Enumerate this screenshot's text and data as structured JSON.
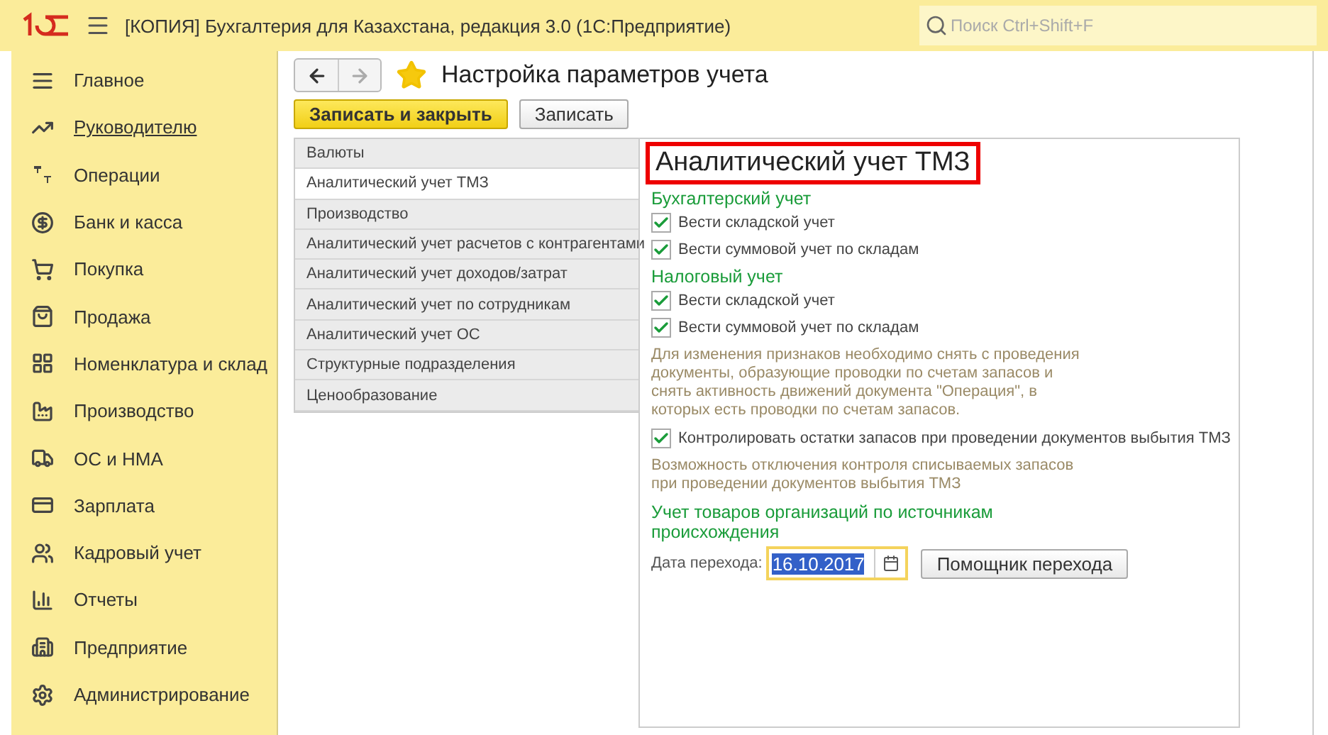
{
  "window": {
    "title": "[КОПИЯ] Бухгалтерия для Казахстана, редакция 3.0  (1С:Предприятие)",
    "search": {
      "placeholder": "Поиск Ctrl+Shift+F"
    }
  },
  "sidebar": {
    "items": [
      {
        "label": "Главное",
        "hovered": false
      },
      {
        "label": "Руководителю",
        "hovered": true
      },
      {
        "label": "Операции",
        "hovered": false
      },
      {
        "label": "Банк и касса",
        "hovered": false
      },
      {
        "label": "Покупка",
        "hovered": false
      },
      {
        "label": "Продажа",
        "hovered": false
      },
      {
        "label": "Номенклатура и склад",
        "hovered": false
      },
      {
        "label": "Производство",
        "hovered": false
      },
      {
        "label": "ОС и НМА",
        "hovered": false
      },
      {
        "label": "Зарплата",
        "hovered": false
      },
      {
        "label": "Кадровый учет",
        "hovered": false
      },
      {
        "label": "Отчеты",
        "hovered": false
      },
      {
        "label": "Предприятие",
        "hovered": false
      },
      {
        "label": "Администрирование",
        "hovered": false
      }
    ]
  },
  "form": {
    "title": "Настройка параметров учета",
    "favorite": true,
    "buttons": [
      {
        "label": "Записать и закрыть",
        "primary": true
      },
      {
        "label": "Записать",
        "primary": false
      }
    ],
    "sections": [
      {
        "label": "Валюты",
        "selected": false
      },
      {
        "label": "Аналитический учет ТМЗ",
        "selected": true
      },
      {
        "label": "Производство",
        "selected": false
      },
      {
        "label": "Аналитический учет расчетов с контрагентами",
        "selected": false
      },
      {
        "label": "Аналитический учет доходов/затрат",
        "selected": false
      },
      {
        "label": "Аналитический учет по сотрудникам",
        "selected": false
      },
      {
        "label": "Аналитический учет ОС",
        "selected": false
      },
      {
        "label": "Структурные подразделения",
        "selected": false
      },
      {
        "label": "Ценообразование",
        "selected": false
      }
    ],
    "panel": {
      "title": "Аналитический учет ТМЗ",
      "highlighted": true,
      "blocks": [
        {
          "kind": "heading",
          "text": "Бухгалтерский учет"
        },
        {
          "kind": "checkbox",
          "text": "Вести складской учет",
          "checked": true
        },
        {
          "kind": "checkbox",
          "text": "Вести суммовой учет по складам",
          "checked": true
        },
        {
          "kind": "heading",
          "text": "Налоговый учет"
        },
        {
          "kind": "checkbox",
          "text": "Вести складской учет",
          "checked": true
        },
        {
          "kind": "checkbox",
          "text": "Вести суммовой учет по складам",
          "checked": true
        },
        {
          "kind": "note",
          "text": "Для изменения признаков необходимо снять с проведения документы, образующие проводки по счетам запасов и снять активность движений документа \"Операция\", в которых есть проводки по счетам запасов."
        },
        {
          "kind": "checkbox",
          "text": "Контролировать остатки запасов при проведении документов выбытия ТМЗ",
          "checked": true
        },
        {
          "kind": "note",
          "text": "Возможность отключения контроля списываемых запасов при проведении документов выбытия ТМЗ"
        },
        {
          "kind": "heading",
          "text": "Учет товаров организаций по источникам происхождения"
        },
        {
          "kind": "date",
          "label": "Дата перехода:",
          "value": "16.10.2017",
          "button": "Помощник перехода"
        }
      ]
    }
  }
}
